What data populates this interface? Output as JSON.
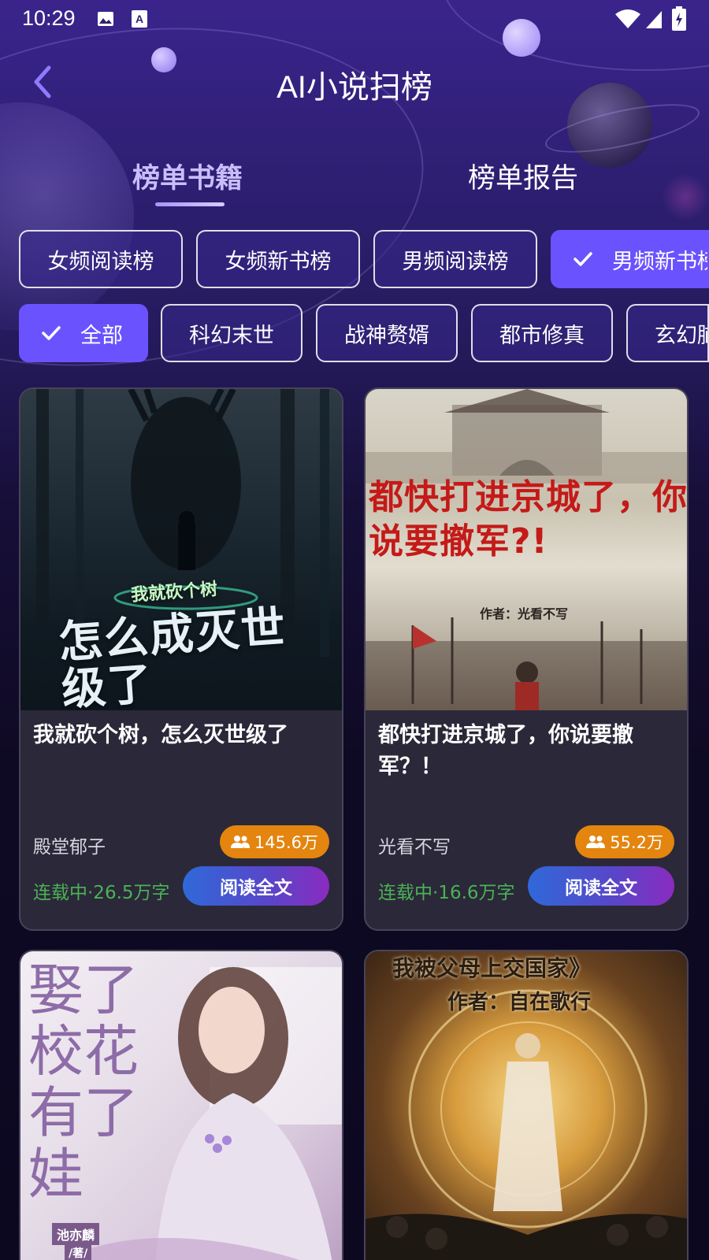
{
  "status_bar": {
    "time": "10:29"
  },
  "header": {
    "title": "AI小说扫榜"
  },
  "tabs": [
    {
      "label": "榜单书籍",
      "active": true
    },
    {
      "label": "榜单报告",
      "active": false
    }
  ],
  "rank_chips": [
    {
      "label": "女频阅读榜",
      "selected": false
    },
    {
      "label": "女频新书榜",
      "selected": false
    },
    {
      "label": "男频阅读榜",
      "selected": false
    },
    {
      "label": "男频新书榜",
      "selected": true
    }
  ],
  "genre_chips": [
    {
      "label": "全部",
      "selected": true
    },
    {
      "label": "科幻末世",
      "selected": false
    },
    {
      "label": "战神赘婿",
      "selected": false
    },
    {
      "label": "都市修真",
      "selected": false
    },
    {
      "label": "玄幻脑",
      "selected": false
    }
  ],
  "books": [
    {
      "cover_text_top": "我就砍个树",
      "cover_text_main": "怎么成灭世级了",
      "title": "我就砍个树，怎么灭世级了",
      "author": "殿堂郁子",
      "readers": "145.6万",
      "status": "连载中·26.5万字",
      "button": "阅读全文"
    },
    {
      "cover_text_main": "都快打进京城了，你说要撤军?!",
      "cover_text_author": "作者：光看不写",
      "title": "都快打进京城了，你说要撤军？！",
      "author": "光看不写",
      "readers": "55.2万",
      "status": "连载中·16.6万字",
      "button": "阅读全文"
    },
    {
      "cover_text_main": "娶了校花有了娃",
      "cover_text_author": "池亦麟",
      "cover_text_note": "/著/"
    },
    {
      "cover_text_main": "我被父母上交国家》",
      "cover_text_author": "作者：自在歌行"
    }
  ],
  "colors": {
    "accent": "#6b52ff",
    "readers_badge": "#e3850f",
    "status_green": "#4bb255",
    "tab_active": "#c9bdfb"
  }
}
